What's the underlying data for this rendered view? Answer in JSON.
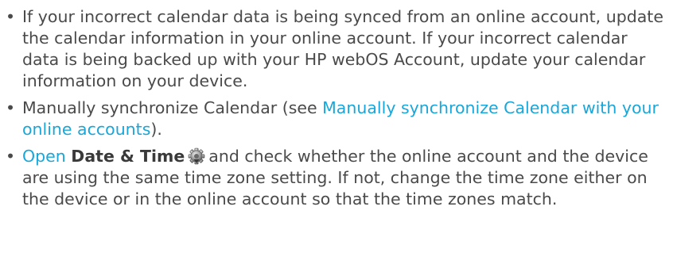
{
  "bullet_char": "•",
  "items": [
    {
      "text": "If your incorrect calendar data is being synced from an online account, update the calendar information in your online account. If your incorrect calendar data is being backed up with your HP webOS Account, update your calendar information on your device."
    },
    {
      "prefix": "Manually synchronize Calendar (see ",
      "link": "Manually synchronize Calendar with your online accounts",
      "suffix": ")."
    },
    {
      "link": "Open",
      "space": " ",
      "bold": "Date & Time",
      "icon": "date-time-gear-icon",
      "rest": "and check whether the online account and the device are using the same time zone setting. If not, change the time zone either on the device or in the online account so that the time zones match."
    }
  ],
  "colors": {
    "text": "#4a4a4a",
    "link": "#1aa6d8"
  }
}
